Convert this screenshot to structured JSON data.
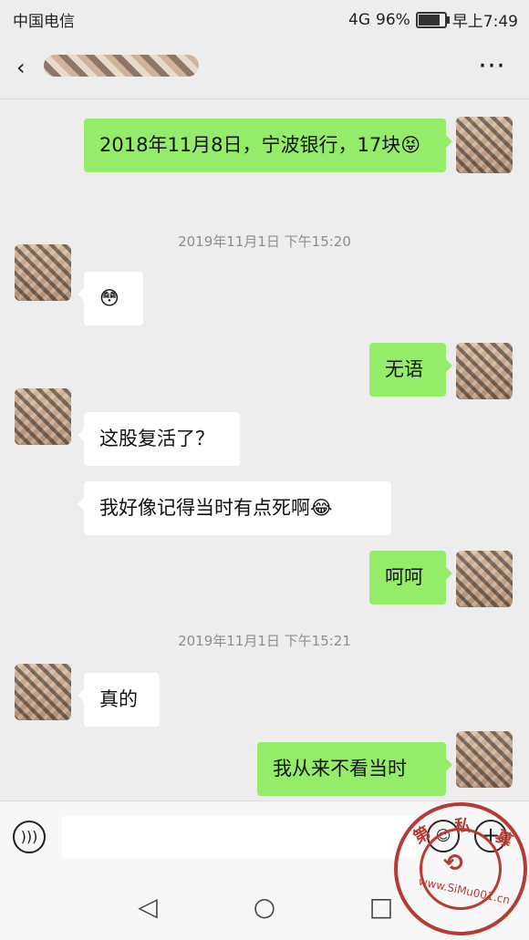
{
  "status": {
    "carrier": "中国电信",
    "signal_icon": "4G",
    "battery_percent": "96%",
    "time": "早上7:49",
    "battery_level": 0.96
  },
  "header": {
    "back_icon": "back-icon",
    "title_icon": "title-mosaic",
    "more_icon": "more-icon"
  },
  "chat": {
    "timestamps": [
      "2019年11月1日 下午15:20",
      "2019年11月1日 下午15:21"
    ],
    "messages": [
      {
        "side": "out",
        "text": "2018年11月8日，宁波银行，17块😝"
      },
      {
        "side": "in",
        "text": "😳"
      },
      {
        "side": "out",
        "text": "无语"
      },
      {
        "side": "in",
        "text": "这股复活了？"
      },
      {
        "side": "in",
        "text": "我好像记得当时有点死啊😂"
      },
      {
        "side": "out",
        "text": "呵呵"
      },
      {
        "side": "in",
        "text": "真的"
      },
      {
        "side": "out",
        "text": "我从来不看当时"
      }
    ]
  },
  "input": {
    "placeholder": ""
  },
  "nav": {
    "back": "◁",
    "home": "○",
    "recent": "□"
  },
  "watermark": {
    "char1": "第",
    "char2": "私",
    "char3": "募",
    "url": "www.SiMu001.cn"
  }
}
